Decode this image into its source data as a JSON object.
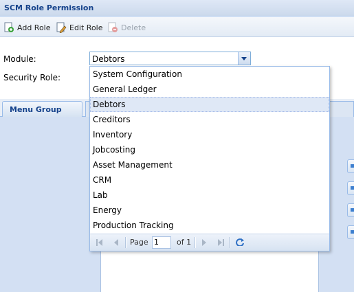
{
  "window": {
    "title": "SCM Role Permission"
  },
  "toolbar": {
    "add_label": "Add Role",
    "edit_label": "Edit Role",
    "delete_label": "Delete"
  },
  "form": {
    "module_label": "Module:",
    "module_value": "Debtors",
    "security_label": "Security Role:"
  },
  "tabs": {
    "menu_group": "Menu Group"
  },
  "dropdown": {
    "options": [
      "System Configuration",
      "General Ledger",
      "Debtors",
      "Creditors",
      "Inventory",
      "Jobcosting",
      "Asset Management",
      "CRM",
      "Lab",
      "Energy",
      "Production Tracking"
    ],
    "selected": "Debtors"
  },
  "pager": {
    "page_label": "Page",
    "page_value": "1",
    "of_label": "of 1"
  },
  "colors": {
    "accent": "#15428b",
    "border": "#99bbe8",
    "selected_row": "#dfe8f6"
  }
}
